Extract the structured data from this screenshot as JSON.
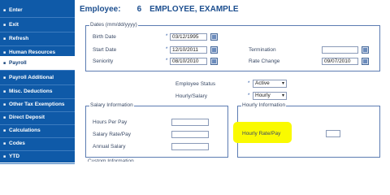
{
  "sidebar": {
    "items": [
      {
        "label": "Enter"
      },
      {
        "label": "Exit"
      },
      {
        "label": "Refresh"
      },
      {
        "label": "Human Resources"
      },
      {
        "label": "Payroll"
      },
      {
        "label": "Payroll Additional"
      },
      {
        "label": "Misc. Deductions"
      },
      {
        "label": "Other Tax Exemptions"
      },
      {
        "label": "Direct Deposit"
      },
      {
        "label": "Calculations"
      },
      {
        "label": "Codes"
      },
      {
        "label": "YTD"
      }
    ],
    "active_index": 4
  },
  "header": {
    "label": "Employee:",
    "number": "6",
    "name": "EMPLOYEE, EXAMPLE"
  },
  "dates": {
    "legend": "Dates (mm/dd/yyyy)",
    "birth_label": "Birth Date",
    "birth_value": "03/12/1995",
    "start_label": "Start Date",
    "start_value": "12/10/2011",
    "seniority_label": "Seniority",
    "seniority_value": "08/10/2010",
    "termination_label": "Termination",
    "termination_value": "",
    "rate_change_label": "Rate Change",
    "rate_change_value": "09/07/2010",
    "required_mark": "*"
  },
  "status": {
    "status_label": "Employee Status",
    "status_value": "Active",
    "hs_label": "Hourly/Salary",
    "hs_value": "Hourly"
  },
  "salary": {
    "legend": "Salary Information",
    "hours_label": "Hours Per Pay",
    "rate_label": "Salary Rate/Pay",
    "annual_label": "Annual Salary",
    "hours_value": "",
    "rate_value": "",
    "annual_value": ""
  },
  "hourly": {
    "legend": "Hourly Information",
    "rate_label": "Hourly Rate/Pay",
    "rate_value": ""
  },
  "footer_partial": "Custom Information",
  "colors": {
    "sidebar": "#0f5aa8",
    "highlight": "#fafa00",
    "header_text": "#1d4f8f"
  }
}
